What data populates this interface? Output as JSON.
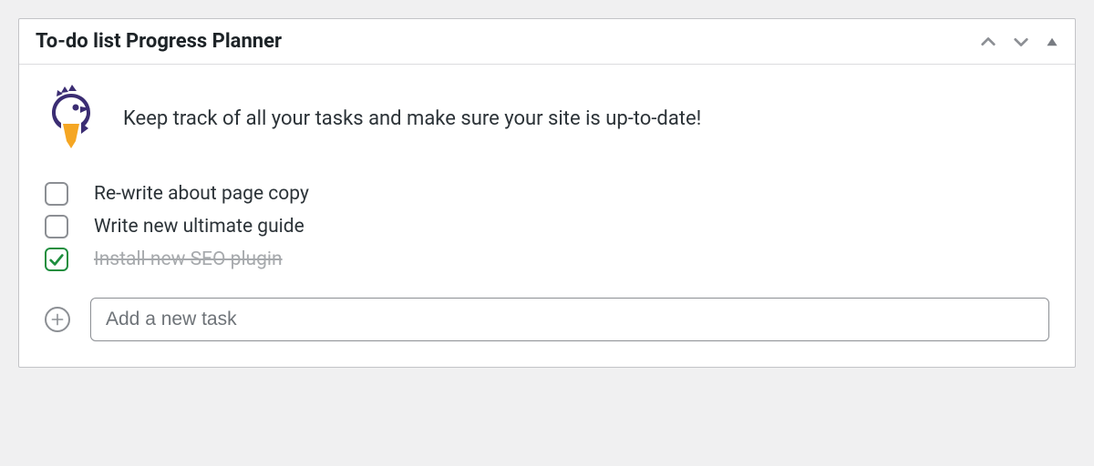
{
  "widget": {
    "title": "To-do list Progress Planner",
    "intro_text": "Keep track of all your tasks and make sure your site is up-to-date!",
    "tasks": [
      {
        "label": "Re-write about page copy",
        "completed": false
      },
      {
        "label": "Write new ultimate guide",
        "completed": false
      },
      {
        "label": "Install new SEO plugin",
        "completed": true
      }
    ],
    "add_task_placeholder": "Add a new task"
  }
}
